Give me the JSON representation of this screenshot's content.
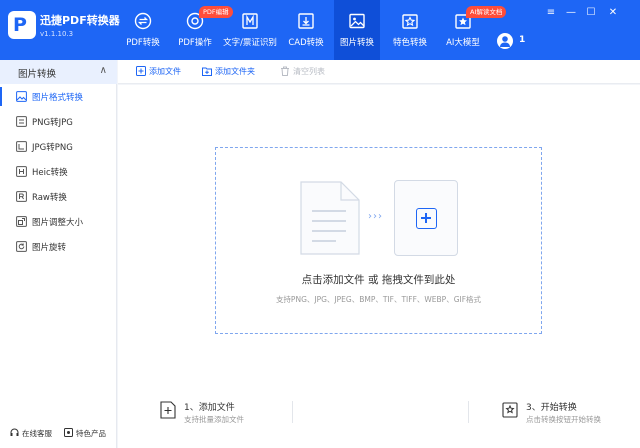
{
  "app": {
    "name": "迅捷PDF转换器",
    "version": "v1.1.10.3"
  },
  "nav": [
    {
      "label": "PDF转换",
      "icon": "convert-icon"
    },
    {
      "label": "PDF操作",
      "icon": "pdf-operate-icon",
      "badge": "PDF编辑"
    },
    {
      "label": "文字/票证识别",
      "icon": "ocr-icon"
    },
    {
      "label": "CAD转换",
      "icon": "cad-icon"
    },
    {
      "label": "图片转换",
      "icon": "image-icon",
      "active": true
    },
    {
      "label": "特色转换",
      "icon": "special-icon"
    },
    {
      "label": "AI大模型",
      "icon": "ai-icon",
      "badge": "AI解读文档"
    }
  ],
  "user": {
    "count": "1"
  },
  "window": {
    "menu": "≡",
    "minimize": "—",
    "maximize": "☐",
    "close": "✕"
  },
  "sidebar": {
    "heading": "图片转换",
    "chevron": "∧",
    "items": [
      {
        "label": "图片格式转换",
        "icon": "image-format-icon",
        "active": true
      },
      {
        "label": "PNG转JPG",
        "icon": "png-jpg-icon"
      },
      {
        "label": "JPG转PNG",
        "icon": "jpg-png-icon"
      },
      {
        "label": "Heic转换",
        "icon": "heic-icon"
      },
      {
        "label": "Raw转换",
        "icon": "raw-icon"
      },
      {
        "label": "图片调整大小",
        "icon": "resize-icon"
      },
      {
        "label": "图片旋转",
        "icon": "rotate-icon"
      }
    ],
    "footer": {
      "service": "在线客服",
      "products": "特色产品"
    }
  },
  "toolbar": {
    "add_file": "添加文件",
    "add_folder": "添加文件夹",
    "clear_list": "清空列表"
  },
  "dropzone": {
    "text": "点击添加文件 或 拖拽文件到此处",
    "formats": "支持PNG、JPG、JPEG、BMP、TIF、TIFF、WEBP、GIF格式",
    "arrows": "›››"
  },
  "steps": [
    {
      "title": "1、添加文件",
      "subtitle": "支持批量添加文件"
    },
    {
      "title": "3、开始转换",
      "subtitle": "点击转换按钮开始转换"
    }
  ],
  "colors": {
    "brand": "#1e66f5",
    "active_nav": "#0f4fd8",
    "badge": "#ff4d3a"
  }
}
